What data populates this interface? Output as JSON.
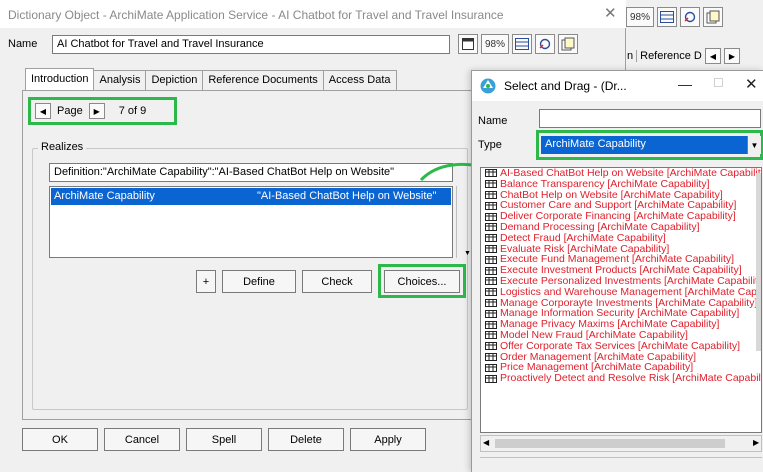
{
  "main_dialog": {
    "title": "Dictionary Object - ArchiMate Application Service - AI Chatbot for Travel and Travel Insurance",
    "close_glyph": "✕",
    "name_label": "Name",
    "name_value": "AI Chatbot for Travel and Travel Insurance",
    "toolbar": {
      "zoom": "98%"
    },
    "tabs": [
      {
        "label": "Introduction"
      },
      {
        "label": "Analysis"
      },
      {
        "label": "Depiction"
      },
      {
        "label": "Reference Documents"
      },
      {
        "label": "Access Data"
      }
    ],
    "page_nav": {
      "label": "Page",
      "count": "7 of 9"
    },
    "realizes": {
      "title": "Realizes",
      "definition": "Definition:\"ArchiMate Capability\":\"AI-Based ChatBot Help on Website\"",
      "selected_row": {
        "type": "ArchiMate Capability",
        "name": "\"AI-Based ChatBot Help on Website\""
      },
      "buttons": {
        "add": "+",
        "define": "Define",
        "check": "Check",
        "choices": "Choices..."
      }
    },
    "bottom_buttons": {
      "ok": "OK",
      "cancel": "Cancel",
      "spell": "Spell",
      "delete": "Delete",
      "apply": "Apply"
    }
  },
  "background_window": {
    "zoom": "98%",
    "tab_partial": "n",
    "tab_label": "Reference D"
  },
  "select_drag": {
    "title": "Select and Drag - (Dr...",
    "minimize_glyph": "—",
    "maximize_glyph": "☐",
    "close_glyph": "✕",
    "name_label": "Name",
    "name_value": "",
    "type_label": "Type",
    "type_value": "ArchiMate Capability",
    "items": [
      "AI-Based ChatBot Help on Website  [ArchiMate Capability]",
      "Balance Transparency  [ArchiMate Capability]",
      "ChatBot Help on Website  [ArchiMate Capability]",
      "Customer Care and Support  [ArchiMate Capability]",
      "Deliver Corporate Financing  [ArchiMate Capability]",
      "Demand Processing  [ArchiMate Capability]",
      "Detect Fraud  [ArchiMate Capability]",
      "Evaluate Risk  [ArchiMate Capability]",
      "Execute Fund Management  [ArchiMate Capability]",
      "Execute Investment Products  [ArchiMate Capability]",
      "Execute Personalized Investments  [ArchiMate Capability]",
      "Logistics and Warehouse Management  [ArchiMate Capability]",
      "Manage Corporayte Investments  [ArchiMate Capability]",
      "Manage Information Security  [ArchiMate Capability]",
      "Manage Privacy Maxims  [ArchiMate Capability]",
      "Model New Fraud  [ArchiMate Capability]",
      "Offer Corporate Tax Services  [ArchiMate Capability]",
      "Order Management  [ArchiMate Capability]",
      "Price Management  [ArchiMate Capability]",
      "Proactively Detect and Resolve Risk  [ArchiMate Capability]"
    ]
  },
  "colors": {
    "highlight_green": "#2db84a",
    "selection_blue": "#0a64d2",
    "list_text_red": "#e0202c"
  },
  "icons": {
    "zoom": "zoom-button",
    "grid": "grid-view-icon",
    "relations": "relations-icon",
    "document": "document-icon",
    "list_item": "table-icon"
  }
}
